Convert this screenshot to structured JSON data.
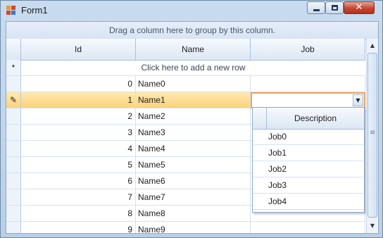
{
  "window": {
    "title": "Form1"
  },
  "group_panel": {
    "text": "Drag a column here to group by this column."
  },
  "columns": {
    "id": "Id",
    "name": "Name",
    "job": "Job"
  },
  "new_row": {
    "indicator": "*",
    "text": "Click here to add a new row"
  },
  "rows": [
    {
      "id": "0",
      "name": "Name0"
    },
    {
      "id": "1",
      "name": "Name1"
    },
    {
      "id": "2",
      "name": "Name2"
    },
    {
      "id": "3",
      "name": "Name3"
    },
    {
      "id": "4",
      "name": "Name4"
    },
    {
      "id": "5",
      "name": "Name5"
    },
    {
      "id": "6",
      "name": "Name6"
    },
    {
      "id": "7",
      "name": "Name7"
    },
    {
      "id": "8",
      "name": "Name8"
    },
    {
      "id": "9",
      "name": "Name9"
    }
  ],
  "current_row_index": 1,
  "job_dropdown": {
    "header": "Description",
    "items": [
      "Job0",
      "Job1",
      "Job2",
      "Job3",
      "Job4"
    ]
  },
  "window_buttons": {
    "close": "✕"
  },
  "colors": {
    "selected_row": "#fbd37a",
    "editor_border": "#f0a35a",
    "header_bg": "#dce7f4"
  }
}
